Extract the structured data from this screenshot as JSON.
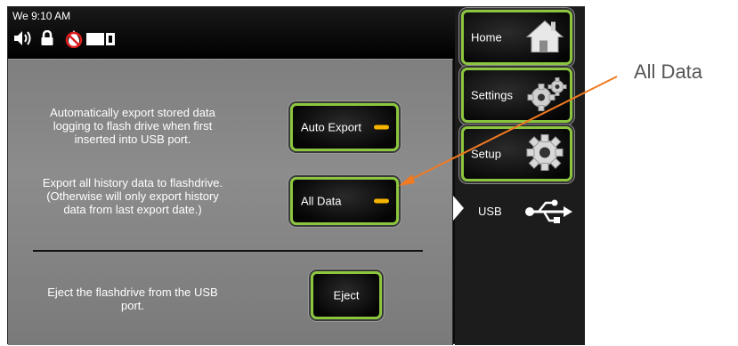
{
  "status_bar": {
    "time": "We 9:10 AM"
  },
  "icons": {
    "speaker": "speaker-icon",
    "lock": "lock-icon",
    "no_water": "no-water-icon",
    "battery": "battery-icon",
    "home": "house-icon",
    "settings": "gears-icon",
    "setup": "gear-icon",
    "usb": "usb-icon"
  },
  "main": {
    "auto_export_desc": "Automatically export stored data logging to flash drive when first inserted into USB port.",
    "auto_export_label": "Auto Export",
    "all_data_desc": "Export all history data to flashdrive. (Otherwise will only export history data from last export date.)",
    "all_data_label": "All Data",
    "eject_desc": "Eject the flashdrive from the USB port.",
    "eject_label": "Eject"
  },
  "sidebar": {
    "home_label": "Home",
    "settings_label": "Settings",
    "setup_label": "Setup",
    "usb_label": "USB"
  },
  "annotation": {
    "callout_label": "All Data"
  },
  "colors": {
    "button_border": "#8cc63f",
    "toggle_on": "#f5b400",
    "arrow": "#f07a20"
  }
}
